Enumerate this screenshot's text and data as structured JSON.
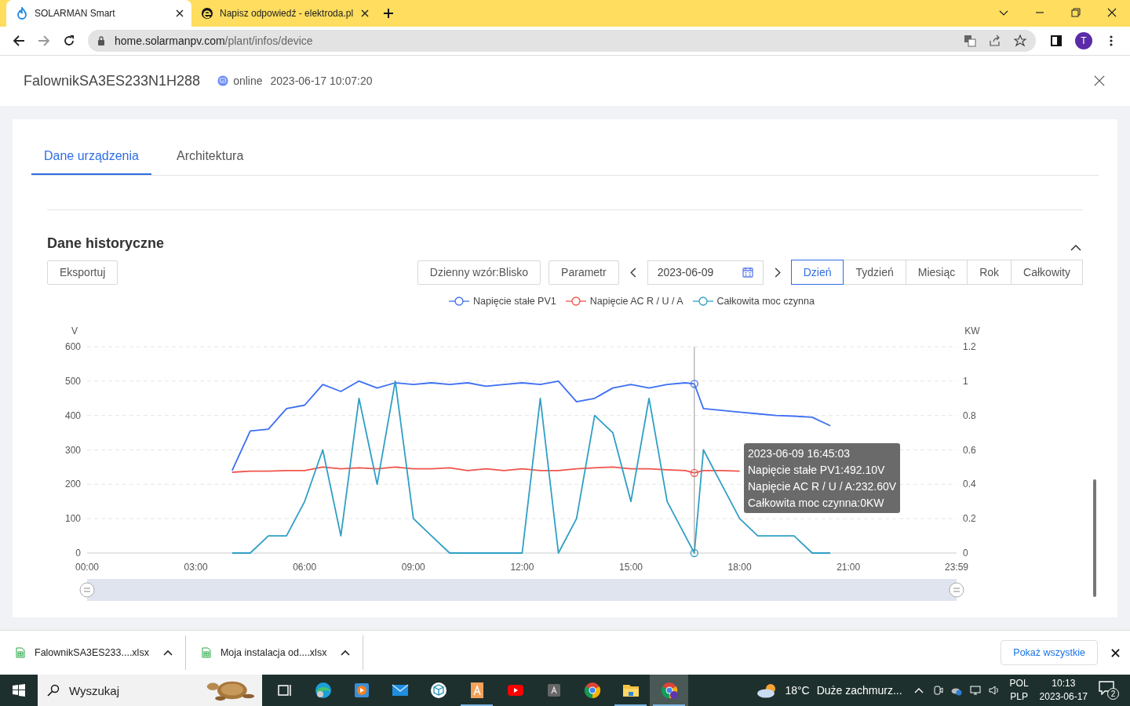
{
  "browser": {
    "tabs": [
      {
        "title": "SOLARMAN Smart",
        "selected": true
      },
      {
        "title": "Napisz odpowiedź - elektroda.pl",
        "selected": false
      }
    ],
    "url_host": "home.solarmanpv.com",
    "url_path": "/plant/infos/device",
    "avatar": "T"
  },
  "device": {
    "name": "FalownikSA3ES233N1H288",
    "status": "online",
    "online": true,
    "timestamp": "2023-06-17 10:07:20"
  },
  "tabs": [
    {
      "label": "Dane urządzenia",
      "selected": true
    },
    {
      "label": "Architektura",
      "selected": false
    }
  ],
  "section": {
    "title": "Dane historyczne",
    "expanded": true,
    "export": "Eksportuj",
    "pattern": "Dzienny wzór:Blisko",
    "parameter": "Parametr",
    "date": "2023-06-09",
    "ranges": [
      {
        "label": "Dzień",
        "selected": true
      },
      {
        "label": "Tydzień",
        "selected": false
      },
      {
        "label": "Miesiąc",
        "selected": false
      },
      {
        "label": "Rok",
        "selected": false
      },
      {
        "label": "Całkowity",
        "selected": false
      }
    ]
  },
  "chart_data": {
    "type": "line",
    "ylabel": "V",
    "y2label": "KW",
    "xlim": [
      0,
      23.983
    ],
    "ylim": [
      0,
      600
    ],
    "y2lim": [
      0,
      1.2
    ],
    "xticks": [
      {
        "value": 0,
        "label": "00:00"
      },
      {
        "value": 3,
        "label": "03:00"
      },
      {
        "value": 6,
        "label": "06:00"
      },
      {
        "value": 9,
        "label": "09:00"
      },
      {
        "value": 12,
        "label": "12:00"
      },
      {
        "value": 15,
        "label": "15:00"
      },
      {
        "value": 18,
        "label": "18:00"
      },
      {
        "value": 21,
        "label": "21:00"
      },
      {
        "value": 23.983,
        "label": "23:59"
      }
    ],
    "yticks": [
      0,
      100,
      200,
      300,
      400,
      500,
      600
    ],
    "y2ticks": [
      0,
      0.2,
      0.4,
      0.6,
      0.8,
      1,
      1.2
    ],
    "x": [
      4,
      4.5,
      5,
      5.5,
      6,
      6.5,
      7,
      7.5,
      8,
      8.5,
      9,
      9.5,
      10,
      10.5,
      11,
      11.5,
      12,
      12.5,
      13,
      13.5,
      14,
      14.5,
      15,
      15.5,
      16,
      16.5,
      16.75,
      17,
      17.5,
      18,
      18.5,
      19,
      19.5,
      20,
      20.5
    ],
    "series": [
      {
        "name": "Napięcie stałe PV1",
        "color": "#3d6ff2",
        "values": [
          240,
          355,
          360,
          420,
          430,
          490,
          470,
          500,
          480,
          495,
          490,
          495,
          490,
          495,
          485,
          490,
          495,
          490,
          500,
          440,
          450,
          480,
          490,
          480,
          490,
          495,
          492,
          420,
          415,
          410,
          405,
          400,
          398,
          395,
          370
        ]
      },
      {
        "name": "Napięcie AC R / U / A",
        "color": "#f0544c",
        "values": [
          235,
          238,
          238,
          240,
          240,
          250,
          245,
          248,
          245,
          250,
          245,
          245,
          248,
          240,
          245,
          240,
          245,
          240,
          240,
          245,
          248,
          250,
          245,
          245,
          242,
          240,
          233,
          240,
          240,
          238,
          null,
          null,
          null,
          null,
          null
        ]
      },
      {
        "name": "Całkowita moc czynna",
        "color": "#2f9fc4",
        "axis": "y2",
        "values": [
          0,
          0,
          0.1,
          0.1,
          0.3,
          0.6,
          0.1,
          0.9,
          0.4,
          1,
          0.2,
          0.1,
          0,
          0,
          0,
          0,
          0,
          0.9,
          0,
          0.2,
          0.8,
          0.7,
          0.3,
          0.9,
          0.3,
          0.1,
          0,
          0.6,
          0.4,
          0.2,
          0.1,
          0.1,
          0.1,
          0,
          0
        ]
      }
    ],
    "grid": true,
    "ref_lines": [
      {
        "axis": "x",
        "value": 16.75
      }
    ]
  },
  "tooltip": {
    "title": "2023-06-09 16:45:03",
    "lines": [
      "Napięcie stałe PV1:492.10V",
      "Napięcie AC R / U / A:232.60V",
      "Całkowita moc czynna:0KW"
    ]
  },
  "downloads": {
    "items": [
      {
        "name": "FalownikSA3ES233....xlsx"
      },
      {
        "name": "Moja instalacja od....xlsx"
      }
    ],
    "show_all": "Pokaż wszystkie"
  },
  "taskbar": {
    "search_placeholder": "Wyszukaj",
    "apps": [
      {
        "kind": "taskview",
        "running": false,
        "selected": false
      },
      {
        "kind": "edge",
        "running": false,
        "selected": false
      },
      {
        "kind": "media",
        "running": false,
        "selected": false
      },
      {
        "kind": "mail",
        "running": false,
        "selected": false
      },
      {
        "kind": "cube",
        "running": false,
        "selected": false
      },
      {
        "kind": "docs",
        "running": true,
        "selected": false
      },
      {
        "kind": "youtube",
        "running": false,
        "selected": false
      },
      {
        "kind": "letter",
        "running": false,
        "selected": false
      },
      {
        "kind": "chrome",
        "running": false,
        "selected": false
      },
      {
        "kind": "folder",
        "running": true,
        "selected": false
      },
      {
        "kind": "chrome-profile",
        "running": true,
        "selected": true
      }
    ],
    "weather_temp": "18°C",
    "weather_text": "Duże zachmurz...",
    "lang_top": "POL",
    "lang_bottom": "PLP",
    "time": "10:13",
    "date": "2023-06-17",
    "notifications": "2"
  }
}
